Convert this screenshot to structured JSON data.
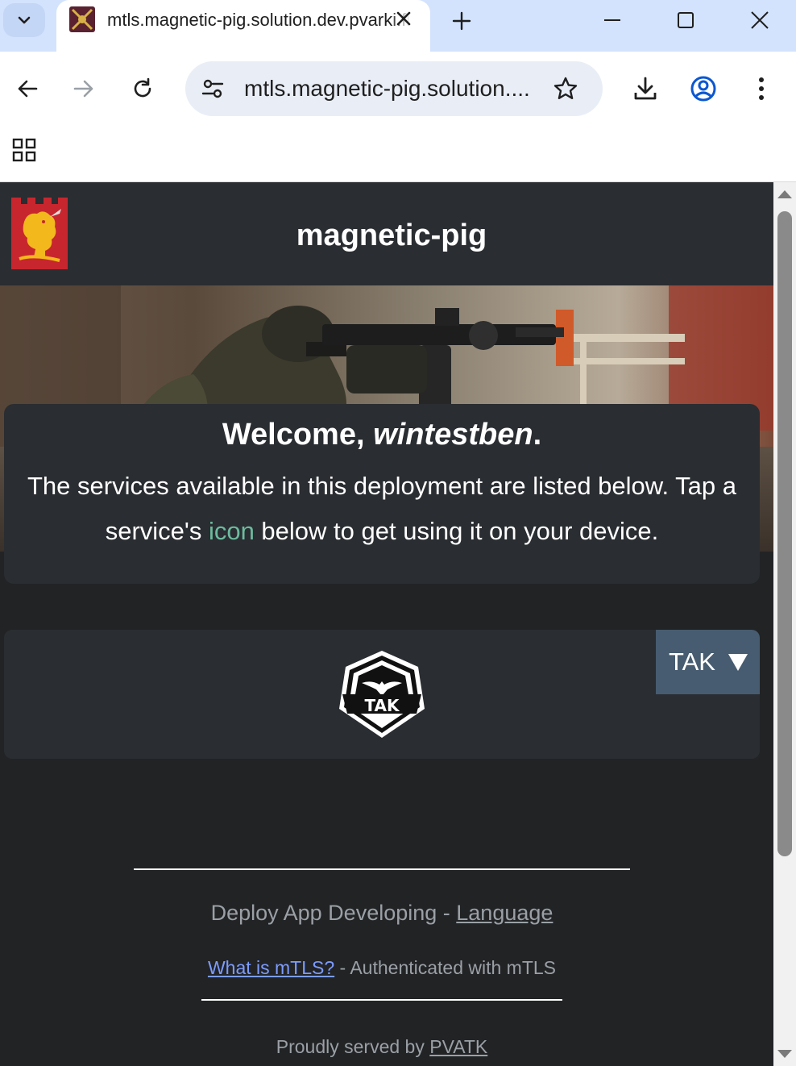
{
  "browser": {
    "tab_title": "mtls.magnetic-pig.solution.dev.pvarki.fi",
    "url_display": "mtls.magnetic-pig.solution...."
  },
  "site": {
    "title": "magnetic-pig"
  },
  "welcome": {
    "greeting": "Welcome, ",
    "username": "wintestben",
    "punct": ".",
    "text_before": "The services available in this deployment are listed below. Tap a service's ",
    "text_accent": "icon",
    "text_after": " below to get using it on your device."
  },
  "service": {
    "dropdown_label": "TAK",
    "logo_text": "TAK"
  },
  "footer": {
    "deploy_text": "Deploy App Developing - ",
    "language_link": "Language",
    "mtls_link": "What is mTLS?",
    "mtls_text": " - Authenticated with mTLS",
    "served_text": "Proudly served by ",
    "pvatk_link": "PVATK"
  },
  "colors": {
    "page_bg": "#222325",
    "card_bg": "#2a2d31",
    "accent": "#6dbb9e",
    "dropdown_bg": "#475c70",
    "link": "#7c9cff",
    "chrome_bg": "#d3e3fd"
  }
}
